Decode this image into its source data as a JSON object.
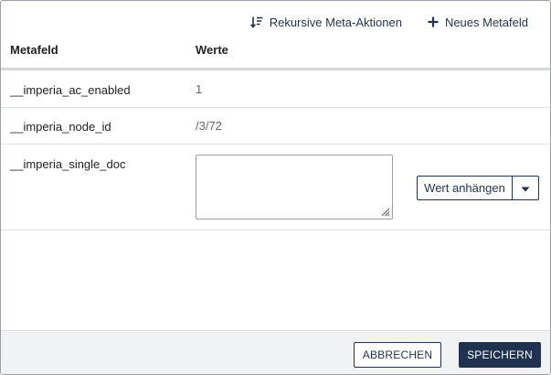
{
  "toolbar": {
    "recursive_label": "Rekursive Meta-Aktionen",
    "recursive_icon": "sort-descending-icon",
    "new_field_label": "Neues Metafeld",
    "new_field_icon": "plus-icon"
  },
  "table": {
    "columns": [
      "Metafeld",
      "Werte"
    ],
    "rows": [
      {
        "key": "__imperia_ac_enabled",
        "value": "1"
      },
      {
        "key": "__imperia_node_id",
        "value": "/3/72"
      },
      {
        "key": "__imperia_single_doc",
        "value": ""
      }
    ]
  },
  "row_editor": {
    "textarea_value": "",
    "append_button_label": "Wert anhängen",
    "append_dropdown_icon": "caret-down-icon"
  },
  "footer": {
    "cancel_label": "ABBRECHEN",
    "save_label": "SPEICHERN"
  },
  "colors": {
    "primary": "#1f3350",
    "footer_bg": "#f1f2f4",
    "divider": "#dcdfe3"
  }
}
